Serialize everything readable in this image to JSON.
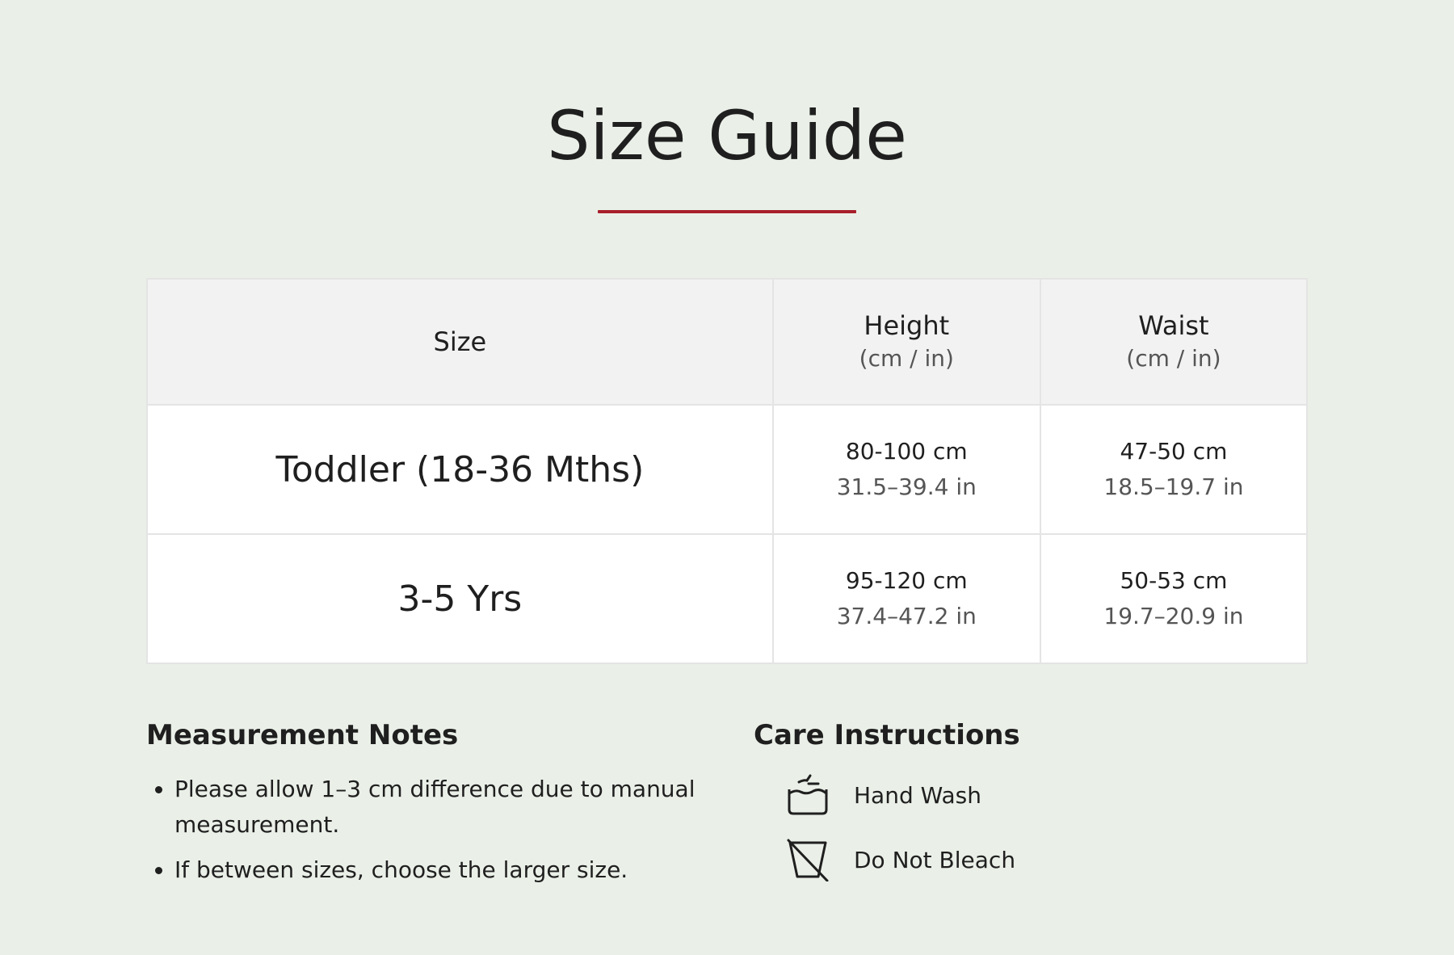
{
  "page": {
    "title": "Size Guide",
    "accent_color": "#a8202b",
    "background_color": "#eaf0e8"
  },
  "table": {
    "headers": {
      "size": "Size",
      "height": "Height",
      "height_unit": "(cm / in)",
      "waist": "Waist",
      "waist_unit": "(cm / in)"
    },
    "rows": [
      {
        "size": "Toddler (18-36 Mths)",
        "height_cm": "80-100 cm",
        "height_in": "31.5–39.4 in",
        "waist_cm": "47-50 cm",
        "waist_in": "18.5–19.7 in"
      },
      {
        "size": "3-5 Yrs",
        "height_cm": "95-120 cm",
        "height_in": "37.4–47.2 in",
        "waist_cm": "50-53 cm",
        "waist_in": "19.7–20.9 in"
      }
    ]
  },
  "notes": {
    "title": "Measurement Notes",
    "items": [
      "Please allow 1–3 cm difference due to manual measurement.",
      "If between sizes, choose the larger size."
    ]
  },
  "care": {
    "title": "Care Instructions",
    "items": [
      {
        "icon": "hand-wash-icon",
        "label": "Hand Wash"
      },
      {
        "icon": "do-not-bleach-icon",
        "label": "Do Not Bleach"
      }
    ]
  }
}
